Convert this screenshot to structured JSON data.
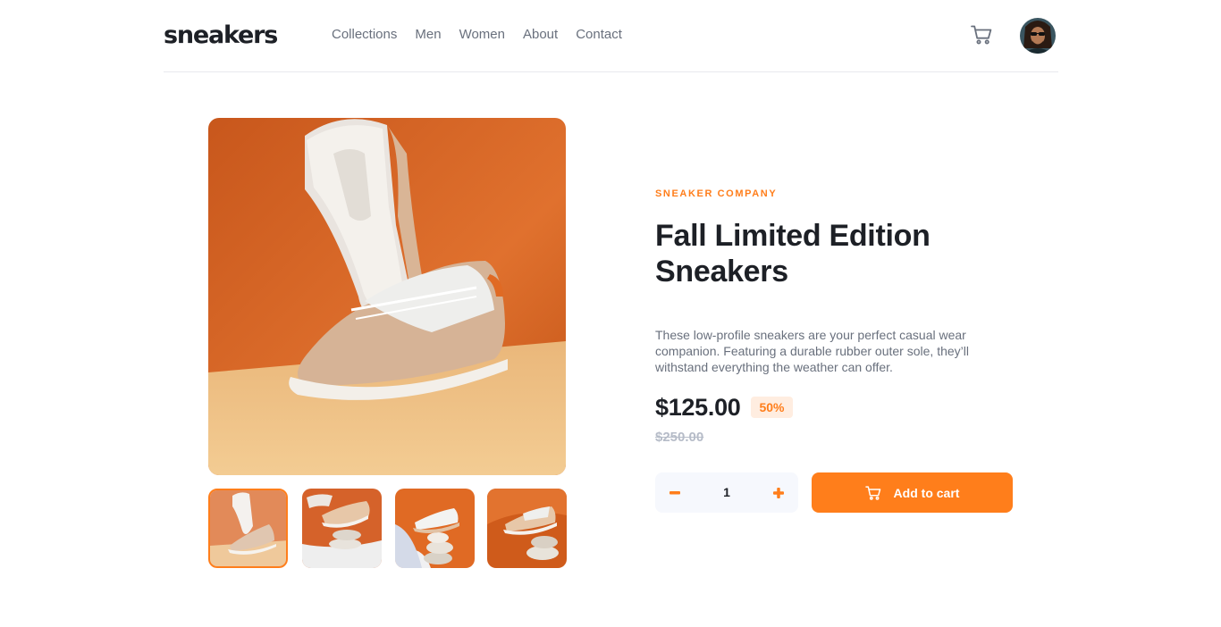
{
  "header": {
    "logo": "sneakers",
    "nav": [
      "Collections",
      "Men",
      "Women",
      "About",
      "Contact"
    ],
    "cart_icon": "cart-icon",
    "avatar": "user-avatar"
  },
  "gallery": {
    "main_image": "shoe-sole-and-side-on-orange-background",
    "thumbnails": [
      "thumbnail-1",
      "thumbnail-2",
      "thumbnail-3",
      "thumbnail-4"
    ],
    "selected_thumbnail": 1
  },
  "product": {
    "company": "SNEAKER COMPANY",
    "title_line1": "Fall Limited Edition",
    "title_line2": "Sneakers",
    "description": "These low-profile sneakers are your perfect casual wear companion. Featuring a durable rubber outer sole, they’ll withstand everything the weather can offer.",
    "price": "$125.00",
    "discount": "50%",
    "original_price": "$250.00",
    "quantity": "1",
    "add_to_cart_label": "Add to cart"
  },
  "colors": {
    "accent": "#ff7e1b",
    "accent_pale": "#ffede0",
    "dark": "#1d2026",
    "muted": "#69707d",
    "light_gray": "#b6bcc8",
    "qty_bg": "#f6f8fd"
  }
}
